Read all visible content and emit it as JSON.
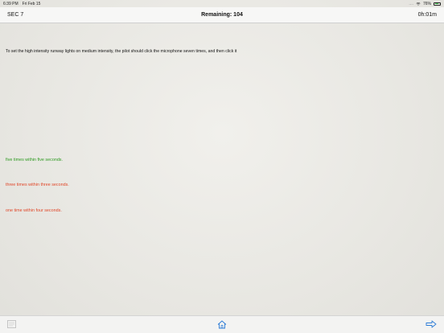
{
  "status_bar": {
    "time": "6:39 PM",
    "date": "Fri Feb 15",
    "signal": "....",
    "battery_percent": "76%"
  },
  "nav": {
    "section": "SEC 7",
    "remaining": "Remaining: 104",
    "timer": "0h:01m"
  },
  "question": {
    "text": "To set the high intensity runway lights on medium intensity, the pilot should click the microphone seven times, and then click it"
  },
  "answers": [
    {
      "text": "five times within five seconds.",
      "color": "#2f9b22"
    },
    {
      "text": "three times within three seconds.",
      "color": "#e0482a"
    },
    {
      "text": "one time within four seconds.",
      "color": "#e0482a"
    }
  ],
  "toolbar": {
    "icons": [
      "notes-icon",
      "home-icon",
      "arrow-right-icon"
    ],
    "accent": "#2a7ad6"
  }
}
